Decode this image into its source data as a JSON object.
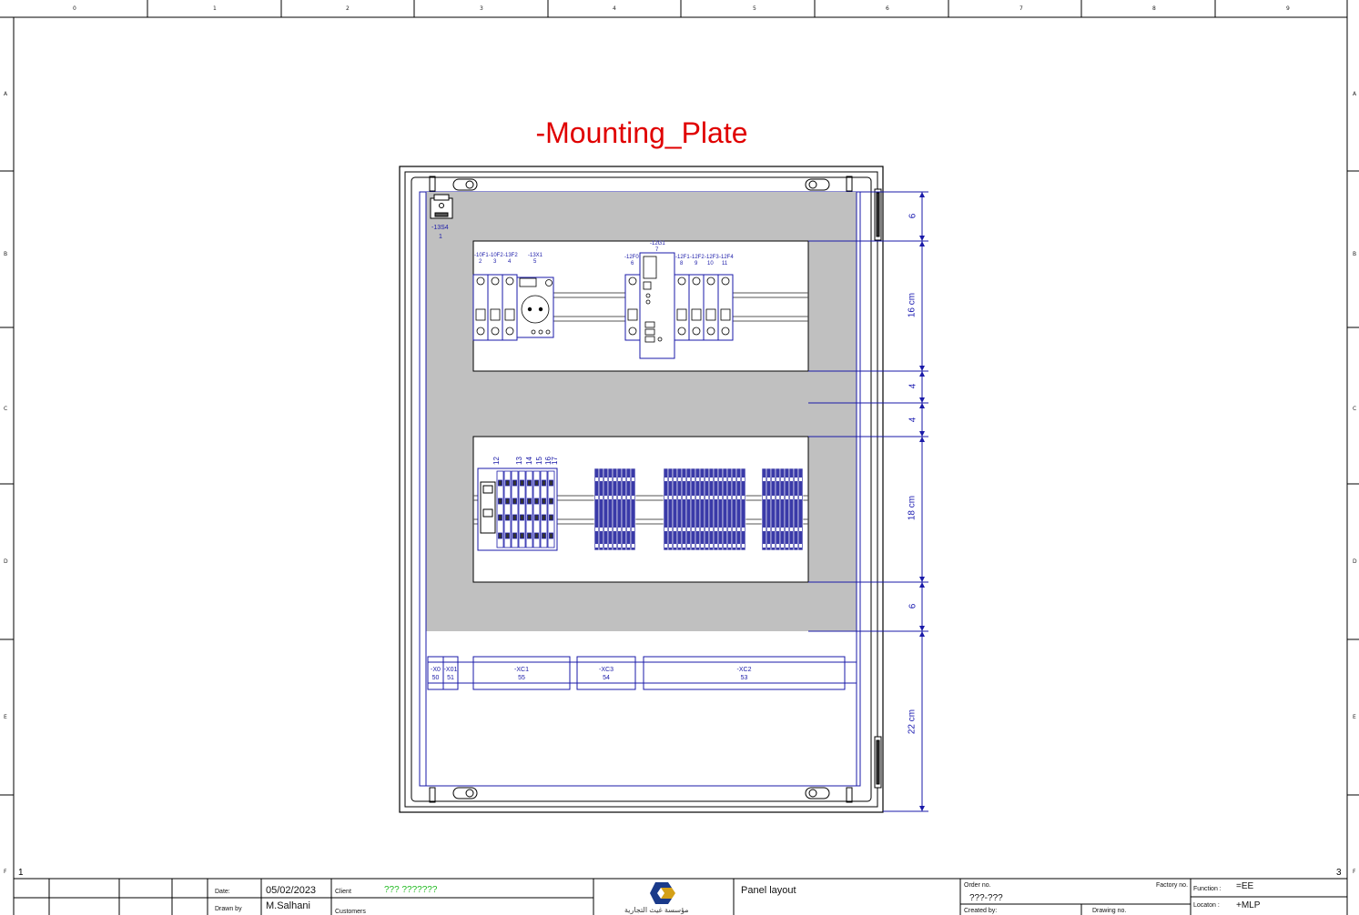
{
  "sheet": {
    "title": "-Mounting_Plate",
    "column_numbers": [
      "0",
      "1",
      "2",
      "3",
      "4",
      "5",
      "6",
      "7",
      "8",
      "9"
    ],
    "row_letters": [
      "A",
      "B",
      "C",
      "D",
      "E",
      "F"
    ],
    "page_left": "1",
    "page_right": "3"
  },
  "dimensions": [
    "6",
    "16 cm",
    "4",
    "4",
    "18 cm",
    "6",
    "22 cm"
  ],
  "top_device": {
    "tag": "-13S4",
    "num": "1"
  },
  "rail1_devices": [
    {
      "tag": "-10F1",
      "num": "2"
    },
    {
      "tag": "-10F2",
      "num": "3"
    },
    {
      "tag": "-13F2",
      "num": "4"
    },
    {
      "tag": "-13X1",
      "num": "5"
    },
    {
      "tag": "-12F0",
      "num": "6"
    },
    {
      "tag": "-12G1",
      "num": "7"
    },
    {
      "tag": "-12F1",
      "num": "8"
    },
    {
      "tag": "-12F2",
      "num": "9"
    },
    {
      "tag": "-12F3",
      "num": "10"
    },
    {
      "tag": "-12F4",
      "num": "11"
    }
  ],
  "rail2_numbers": [
    "12",
    "13",
    "14",
    "15",
    "16",
    "17"
  ],
  "terminals": [
    {
      "tag": "-X0",
      "num": "50"
    },
    {
      "tag": "-X01",
      "num": "51"
    },
    {
      "tag": "-XC1",
      "num": "55"
    },
    {
      "tag": "-XC3",
      "num": "54"
    },
    {
      "tag": "-XC2",
      "num": "53"
    }
  ],
  "title_block": {
    "date_label": "Date:",
    "date_value": "05/02/2023",
    "drawn_label": "Drawn by",
    "drawn_value": "M.Salhani",
    "client_label": "Client",
    "client_value": "??? ???????",
    "customers_label": "Customers",
    "description": "Panel layout",
    "order_label": "Order no.",
    "order_value": "???-???",
    "factory_label": "Factory no.",
    "created_label": "Created by:",
    "drawing_label": "Drawing no.",
    "function_label": "Function :",
    "function_value": "=EE",
    "location_label": "Locaton :",
    "location_value": "+MLP",
    "logo_text": "مؤسسة غيث التجارية"
  },
  "colors": {
    "frame": "#000000",
    "device_blue": "#1a1aa8",
    "mounting_grey": "#c0c0c0",
    "title_red": "#e00000",
    "client_green": "#22bb22"
  }
}
